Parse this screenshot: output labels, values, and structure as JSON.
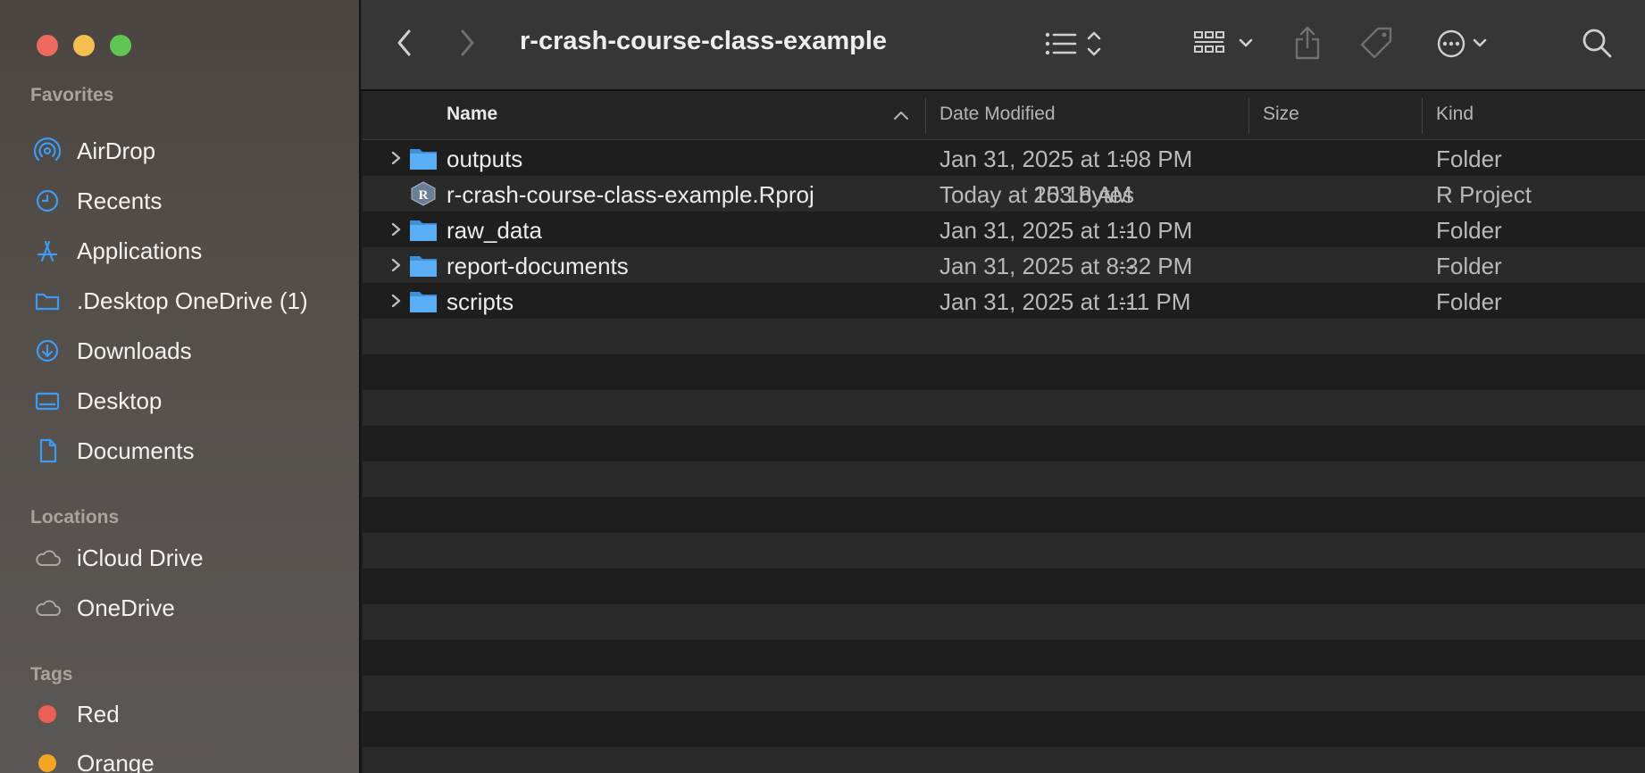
{
  "window": {
    "title": "r-crash-course-class-example"
  },
  "sidebar": {
    "favorites_label": "Favorites",
    "favorites": [
      {
        "label": "AirDrop",
        "icon": "airdrop-icon"
      },
      {
        "label": "Recents",
        "icon": "clock-icon"
      },
      {
        "label": "Applications",
        "icon": "applications-icon"
      },
      {
        "label": ".Desktop OneDrive (1)",
        "icon": "folder-icon"
      },
      {
        "label": "Downloads",
        "icon": "download-icon"
      },
      {
        "label": "Desktop",
        "icon": "desktop-icon"
      },
      {
        "label": "Documents",
        "icon": "document-icon"
      }
    ],
    "locations_label": "Locations",
    "locations": [
      {
        "label": "iCloud Drive",
        "icon": "cloud-icon"
      },
      {
        "label": "OneDrive",
        "icon": "cloud-icon"
      }
    ],
    "tags_label": "Tags",
    "tags": [
      {
        "label": "Red",
        "color": "#ec5f57"
      },
      {
        "label": "Orange",
        "color": "#f5a524"
      }
    ]
  },
  "columns": {
    "name": "Name",
    "date": "Date Modified",
    "size": "Size",
    "kind": "Kind"
  },
  "files": [
    {
      "name": "outputs",
      "date": "Jan 31, 2025 at 1:08 PM",
      "size": "--",
      "kind": "Folder",
      "type": "folder"
    },
    {
      "name": "r-crash-course-class-example.Rproj",
      "date": "Today at 10:18 AM",
      "size": "253 bytes",
      "kind": "R Project",
      "type": "rproj"
    },
    {
      "name": "raw_data",
      "date": "Jan 31, 2025 at 1:10 PM",
      "size": "--",
      "kind": "Folder",
      "type": "folder"
    },
    {
      "name": "report-documents",
      "date": "Jan 31, 2025 at 8:32 PM",
      "size": "--",
      "kind": "Folder",
      "type": "folder"
    },
    {
      "name": "scripts",
      "date": "Jan 31, 2025 at 1:11 PM",
      "size": "--",
      "kind": "Folder",
      "type": "folder"
    }
  ],
  "colors": {
    "accent_blue": "#3e9bf4",
    "folder_blue": "#4aa6f0"
  }
}
